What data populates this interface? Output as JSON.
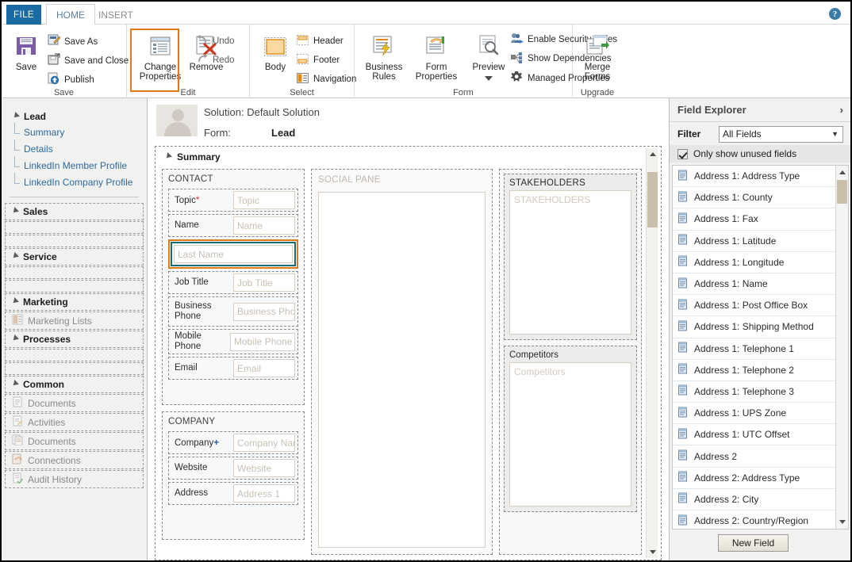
{
  "window": {
    "accent_blue": "#1a6ba4",
    "accent_orange": "#e07b10",
    "select_teal": "#176b78"
  },
  "tabs": {
    "file": "FILE",
    "home": "HOME",
    "insert": "INSERT",
    "help_glyph": "?"
  },
  "ribbon": {
    "groups": [
      {
        "label": "Save"
      },
      {
        "label": "Edit"
      },
      {
        "label": "Select"
      },
      {
        "label": "Form"
      },
      {
        "label": "Upgrade"
      }
    ],
    "save": {
      "big": "Save",
      "save_as": "Save As",
      "save_and_close": "Save and Close",
      "publish": "Publish"
    },
    "edit": {
      "change_properties": "Change\nProperties",
      "change_properties_l1": "Change",
      "change_properties_l2": "Properties",
      "remove": "Remove",
      "undo": "Undo",
      "redo": "Redo"
    },
    "select": {
      "body": "Body",
      "header": "Header",
      "footer": "Footer",
      "navigation": "Navigation"
    },
    "form": {
      "business_rules_l1": "Business",
      "business_rules_l2": "Rules",
      "form_properties_l1": "Form",
      "form_properties_l2": "Properties",
      "preview": "Preview",
      "enable_security_roles": "Enable Security Roles",
      "show_dependencies": "Show Dependencies",
      "managed_properties": "Managed Properties"
    },
    "upgrade": {
      "merge_forms_l1": "Merge",
      "merge_forms_l2": "Forms"
    }
  },
  "sidebar": {
    "lead": {
      "title": "Lead",
      "links": [
        "Summary",
        "Details",
        "LinkedIn Member Profile",
        "LinkedIn Company Profile"
      ]
    },
    "sections": [
      {
        "title": "Sales",
        "items": []
      },
      {
        "title": "Service",
        "items": []
      },
      {
        "title": "Marketing",
        "items": [
          "Marketing Lists"
        ]
      },
      {
        "title": "Processes",
        "items": []
      },
      {
        "title": "Common",
        "items": [
          "Documents",
          "Activities",
          "Documents",
          "Connections",
          "Audit History"
        ]
      }
    ]
  },
  "form_header": {
    "solution_label": "Solution: Default Solution",
    "form_label": "Form:",
    "form_name": "Lead"
  },
  "form": {
    "tab_title": "Summary",
    "contact": {
      "title": "CONTACT",
      "fields": [
        {
          "label": "Topic",
          "marker": "required",
          "placeholder": "Topic"
        },
        {
          "label": "Name",
          "marker": "",
          "placeholder": "Name"
        },
        {
          "label": "",
          "marker": "selected",
          "placeholder": "Last Name"
        },
        {
          "label": "Job Title",
          "marker": "",
          "placeholder": "Job Title"
        },
        {
          "label": "Business Phone",
          "marker": "",
          "placeholder": "Business Phone"
        },
        {
          "label": "Mobile Phone",
          "marker": "",
          "placeholder": "Mobile Phone"
        },
        {
          "label": "Email",
          "marker": "",
          "placeholder": "Email"
        }
      ]
    },
    "company": {
      "title": "COMPANY",
      "fields": [
        {
          "label": "Company",
          "marker": "recommended",
          "placeholder": "Company Name"
        },
        {
          "label": "Website",
          "marker": "",
          "placeholder": "Website"
        },
        {
          "label": "Address",
          "marker": "",
          "placeholder": "Address 1"
        }
      ]
    },
    "social_pane": {
      "title": "SOCIAL PANE"
    },
    "stakeholders": {
      "title": "STAKEHOLDERS",
      "body": "STAKEHOLDERS"
    },
    "competitors": {
      "title": "Competitors",
      "body": "Competitors"
    }
  },
  "field_explorer": {
    "title": "Field Explorer",
    "chevron": "›",
    "filter_label": "Filter",
    "filter_value": "All Fields",
    "checkbox_label": "Only show unused fields",
    "checkbox_checked": true,
    "new_field_button": "New Field",
    "fields": [
      "Address 1: Address Type",
      "Address 1: County",
      "Address 1: Fax",
      "Address 1: Latitude",
      "Address 1: Longitude",
      "Address 1: Name",
      "Address 1: Post Office Box",
      "Address 1: Shipping Method",
      "Address 1: Telephone 1",
      "Address 1: Telephone 2",
      "Address 1: Telephone 3",
      "Address 1: UPS Zone",
      "Address 1: UTC Offset",
      "Address 2",
      "Address 2: Address Type",
      "Address 2: City",
      "Address 2: Country/Region"
    ]
  }
}
